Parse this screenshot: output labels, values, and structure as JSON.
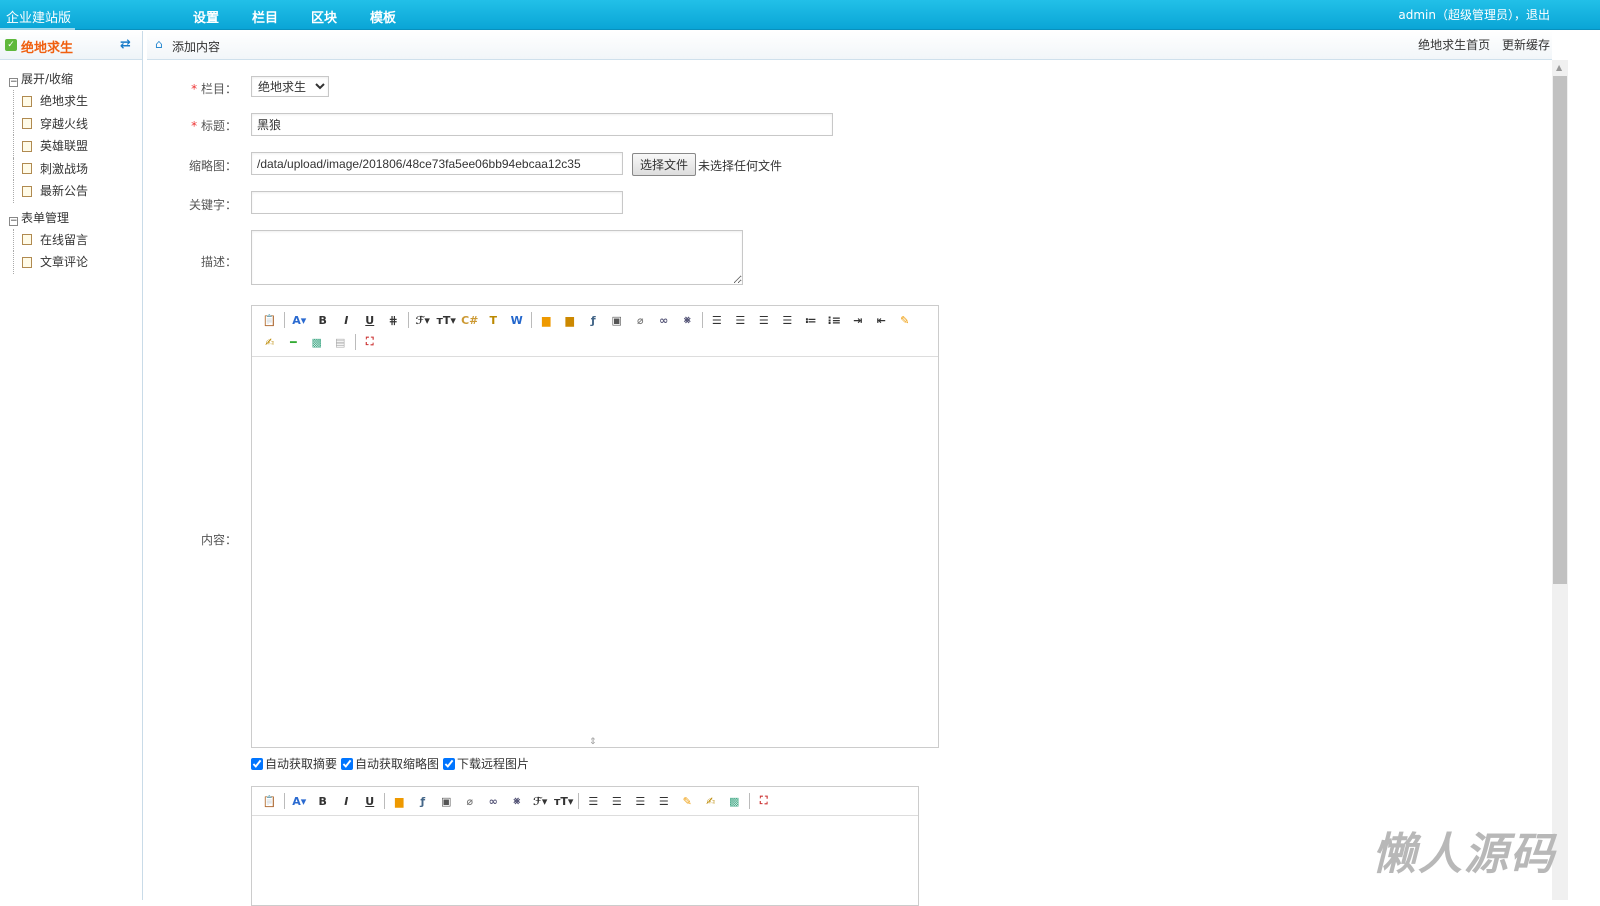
{
  "topbar": {
    "brand": "企业建站版",
    "nav": [
      "设置",
      "栏目",
      "区块",
      "模板"
    ],
    "user": "admin（超级管理员），退出"
  },
  "sidebar": {
    "title": "绝地求生",
    "groups": [
      {
        "label": "展开/收缩",
        "items": [
          "绝地求生",
          "穿越火线",
          "英雄联盟",
          "刺激战场",
          "最新公告"
        ]
      },
      {
        "label": "表单管理",
        "items": [
          "在线留言",
          "文章评论"
        ]
      }
    ]
  },
  "header": {
    "breadcrumb": "添加内容",
    "links": [
      "绝地求生首页",
      "更新缓存"
    ]
  },
  "form": {
    "column_label": "栏目：",
    "column_value": "绝地求生",
    "title_label": "标题：",
    "title_value": "黑狼",
    "thumb_label": "缩略图：",
    "thumb_value": "/data/upload/image/201806/48ce73fa5ee06bb94ebcaa12c35",
    "choose_file": "选择文件",
    "no_file": "未选择任何文件",
    "keywords_label": "关键字：",
    "keywords_value": "",
    "desc_label": "描述：",
    "desc_value": "",
    "content_label": "内容：",
    "checks": [
      {
        "label": "自动获取摘要",
        "checked": true
      },
      {
        "label": "自动获取缩略图",
        "checked": true
      },
      {
        "label": "下载远程图片",
        "checked": true
      }
    ]
  },
  "toolbar1": [
    {
      "n": "paste-icon",
      "g": "📋"
    },
    {
      "n": "sep"
    },
    {
      "n": "font-color-icon",
      "g": "A▾",
      "c": "#2a6ad0"
    },
    {
      "n": "bold-icon",
      "g": "B"
    },
    {
      "n": "italic-icon",
      "g": "I"
    },
    {
      "n": "underline-icon",
      "g": "U"
    },
    {
      "n": "strikethrough-icon",
      "g": "⋕"
    },
    {
      "n": "sep"
    },
    {
      "n": "font-family-icon",
      "g": "ℱ▾"
    },
    {
      "n": "font-size-icon",
      "g": "тT▾"
    },
    {
      "n": "code-icon",
      "g": "C#",
      "c": "#c93"
    },
    {
      "n": "paste-text-icon",
      "g": "T",
      "c": "#b80"
    },
    {
      "n": "paste-word-icon",
      "g": "W",
      "c": "#26c"
    },
    {
      "n": "sep"
    },
    {
      "n": "image-icon",
      "g": "▆",
      "c": "#e90"
    },
    {
      "n": "multi-image-icon",
      "g": "▆",
      "c": "#c80"
    },
    {
      "n": "flash-icon",
      "g": "ƒ",
      "c": "#468"
    },
    {
      "n": "video-icon",
      "g": "▣",
      "c": "#555"
    },
    {
      "n": "attachment-icon",
      "g": "⌀",
      "c": "#777"
    },
    {
      "n": "link-icon",
      "g": "∞",
      "c": "#557"
    },
    {
      "n": "unlink-icon",
      "g": "⨳",
      "c": "#557"
    },
    {
      "n": "sep"
    },
    {
      "n": "align-left-icon",
      "g": "☰"
    },
    {
      "n": "align-center-icon",
      "g": "☰"
    },
    {
      "n": "align-right-icon",
      "g": "☰"
    },
    {
      "n": "justify-icon",
      "g": "☰"
    },
    {
      "n": "ordered-list-icon",
      "g": "≔"
    },
    {
      "n": "unordered-list-icon",
      "g": "⁝≡"
    },
    {
      "n": "indent-icon",
      "g": "⇥"
    },
    {
      "n": "outdent-icon",
      "g": "⇤"
    },
    {
      "n": "clear-format-icon",
      "g": "✎",
      "c": "#e90"
    },
    {
      "n": "quick-format-icon",
      "g": "✍",
      "c": "#b80"
    },
    {
      "n": "insert-hr-icon",
      "g": "━",
      "c": "#3a3"
    },
    {
      "n": "insert-template-icon",
      "g": "▩",
      "c": "#4a8"
    },
    {
      "n": "page-break-icon",
      "g": "▤",
      "c": "#aaa"
    },
    {
      "n": "sep"
    },
    {
      "n": "fullscreen-icon",
      "g": "⛶",
      "c": "#c33"
    }
  ],
  "toolbar2": [
    {
      "n": "paste-icon",
      "g": "📋"
    },
    {
      "n": "sep"
    },
    {
      "n": "font-color-icon",
      "g": "A▾",
      "c": "#2a6ad0"
    },
    {
      "n": "bold-icon",
      "g": "B"
    },
    {
      "n": "italic-icon",
      "g": "I"
    },
    {
      "n": "underline-icon",
      "g": "U"
    },
    {
      "n": "sep"
    },
    {
      "n": "image-icon",
      "g": "▆",
      "c": "#e90"
    },
    {
      "n": "flash-icon",
      "g": "ƒ",
      "c": "#468"
    },
    {
      "n": "video-icon",
      "g": "▣",
      "c": "#555"
    },
    {
      "n": "attachment-icon",
      "g": "⌀",
      "c": "#777"
    },
    {
      "n": "link-icon",
      "g": "∞",
      "c": "#557"
    },
    {
      "n": "unlink-icon",
      "g": "⨳",
      "c": "#557"
    },
    {
      "n": "font-family-icon",
      "g": "ℱ▾"
    },
    {
      "n": "font-size-icon",
      "g": "тT▾"
    },
    {
      "n": "sep"
    },
    {
      "n": "align-left-icon",
      "g": "☰"
    },
    {
      "n": "align-center-icon",
      "g": "☰"
    },
    {
      "n": "align-right-icon",
      "g": "☰"
    },
    {
      "n": "justify-icon",
      "g": "☰"
    },
    {
      "n": "clear-format-icon",
      "g": "✎",
      "c": "#e90"
    },
    {
      "n": "quick-format-icon",
      "g": "✍",
      "c": "#b80"
    },
    {
      "n": "insert-template-icon",
      "g": "▩",
      "c": "#4a8"
    },
    {
      "n": "sep"
    },
    {
      "n": "fullscreen-icon",
      "g": "⛶",
      "c": "#c33"
    }
  ],
  "watermark": "懒人源码"
}
